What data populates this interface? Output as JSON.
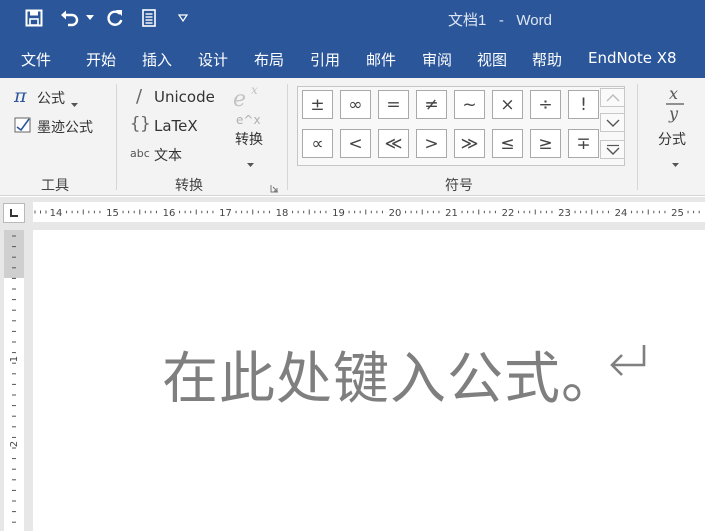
{
  "titlebar": {
    "doc_name": "文档1",
    "separator": "-",
    "app_name": "Word"
  },
  "menu": {
    "tabs": [
      "文件",
      "开始",
      "插入",
      "设计",
      "布局",
      "引用",
      "邮件",
      "审阅",
      "视图",
      "帮助",
      "EndNote X8"
    ]
  },
  "ribbon": {
    "tools": {
      "equation_label": "公式",
      "ink_equation_label": "墨迹公式",
      "group_label": "工具"
    },
    "conversions": {
      "unicode_label": "Unicode",
      "latex_label": "LaTeX",
      "text_label": "文本",
      "text_prefix": "abc",
      "convert_label": "转换",
      "group_label": "转换"
    },
    "symbols": {
      "row1": [
        "±",
        "∞",
        "=",
        "≠",
        "~",
        "×",
        "÷",
        "!"
      ],
      "row2": [
        "∝",
        "<",
        "≪",
        ">",
        "≫",
        "≤",
        "≥",
        "∓"
      ],
      "group_label": "符号"
    },
    "structures": {
      "fraction_label": "分式"
    }
  },
  "ruler": {
    "numbers": [
      "14",
      "15",
      "16",
      "17",
      "18",
      "19",
      "20",
      "21",
      "22",
      "23",
      "24",
      "25"
    ],
    "vertical_numbers": [
      "1",
      "2"
    ]
  },
  "document": {
    "equation_placeholder": "在此处键入公式。"
  },
  "colors": {
    "title_blue": "#2b579a",
    "ribbon_bg": "#f3f3f3",
    "placeholder_gray": "#7f7f7f"
  }
}
